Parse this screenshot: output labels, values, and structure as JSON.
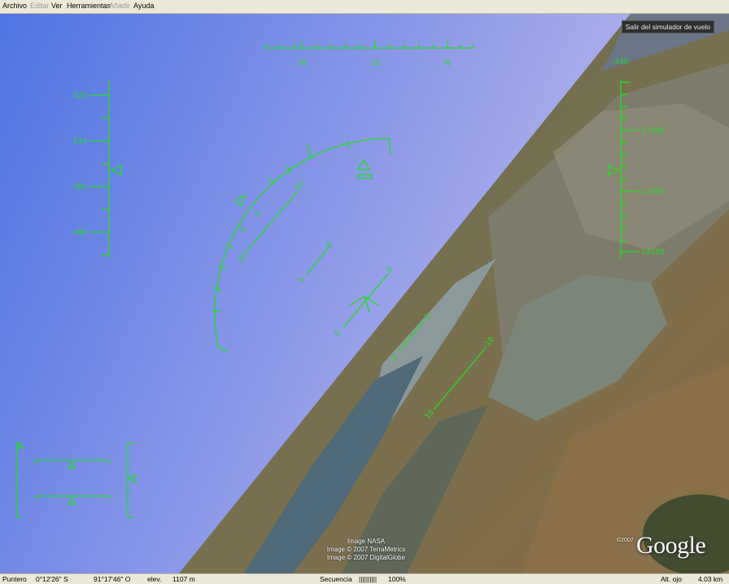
{
  "menu": [
    {
      "label": "Archivo",
      "enabled": true
    },
    {
      "label": "Editar",
      "enabled": false
    },
    {
      "label": "Ver",
      "enabled": true
    },
    {
      "label": "Herramientas",
      "enabled": true
    },
    {
      "label": "Añadir",
      "enabled": false
    },
    {
      "label": "Ayuda",
      "enabled": true
    }
  ],
  "exit_button": "Salir del simulador de vuelo",
  "hud": {
    "color": "#1ee01e",
    "heading_labels": [
      "30",
      "33",
      "N"
    ],
    "speed_labels": [
      "520",
      "510",
      "500",
      "490"
    ],
    "vertical_speed": "-240",
    "altitude_labels": [
      "13300",
      "13200",
      "13100"
    ],
    "pitch_arc_labels": [
      "10",
      "10"
    ],
    "pitch_small_labels": [
      "5",
      "5"
    ],
    "pitch_zero_labels": [
      "0",
      "0"
    ],
    "pitch_lower_labels": [
      "-5",
      "5"
    ],
    "pitch_neg_labels": [
      "-10",
      "10"
    ]
  },
  "credits": {
    "line1": "Image NASA",
    "line2": "Image © 2007 TerraMetrics",
    "line3": "Image © 2007 DigitalGlobe",
    "logo_year": "©2007",
    "logo": "Google"
  },
  "status": {
    "pointer_label": "Puntero",
    "lat": "0°12'26\" S",
    "lon": "91°17'46\" O",
    "elev_label": "elev.",
    "elev": "1107 m",
    "stream_label": "Secuencia",
    "stream_bar": "||||||||||",
    "stream_pct": "100%",
    "eye_label": "Alt. ojo",
    "eye": "4.03 km"
  }
}
